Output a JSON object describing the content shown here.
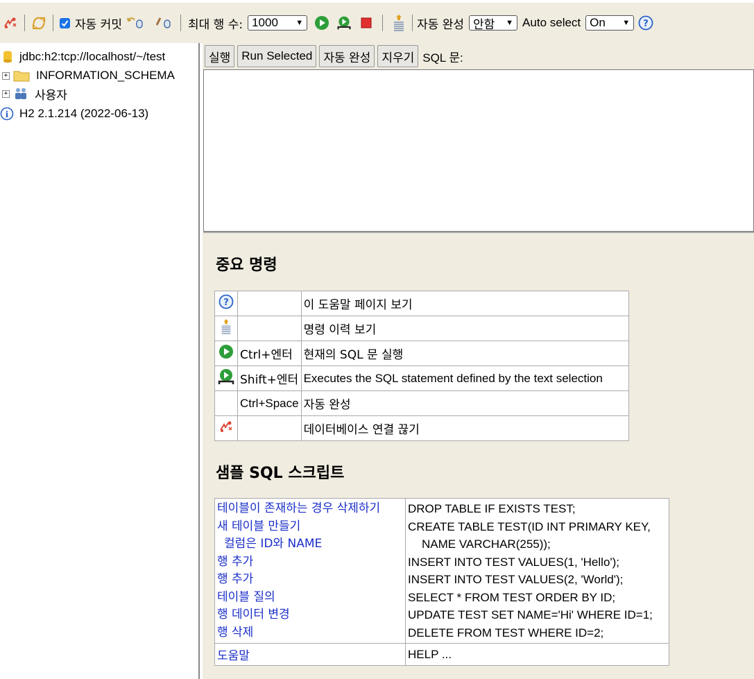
{
  "toolbar": {
    "autocommit_label": "자동 커밋",
    "autocommit_checked": true,
    "max_rows_label": "최대 행 수:",
    "max_rows_value": "1000",
    "autocomplete_label": "자동 완성",
    "autocomplete_value": "안함",
    "autoselect_label": "Auto select",
    "autoselect_value": "On"
  },
  "sidebar": {
    "connection": "jdbc:h2:tcp://localhost/~/test",
    "schema": "INFORMATION_SCHEMA",
    "users": "사용자",
    "version": "H2 2.1.214 (2022-06-13)"
  },
  "query_bar": {
    "run": "실행",
    "run_selected": "Run Selected",
    "autocomplete": "자동 완성",
    "clear": "지우기",
    "sql_label": "SQL 문:"
  },
  "editor": {
    "value": ""
  },
  "help": {
    "important_title": "중요 명령",
    "commands": [
      {
        "icon": "help-icon",
        "key": "",
        "desc": "이 도움말 페이지 보기"
      },
      {
        "icon": "history-icon",
        "key": "",
        "desc": "명령 이력 보기"
      },
      {
        "icon": "run-icon",
        "key": "Ctrl+엔터",
        "desc": "현재의 SQL 문 실행"
      },
      {
        "icon": "run-selected-icon",
        "key": "Shift+엔터",
        "desc": "Executes the SQL statement defined by the text selection"
      },
      {
        "icon": "",
        "key": "Ctrl+Space",
        "desc": "자동 완성"
      },
      {
        "icon": "disconnect-icon",
        "key": "",
        "desc": "데이터베이스 연결 끊기"
      }
    ],
    "sample_title": "샘플 SQL 스크립트",
    "sample_links": [
      "테이블이 존재하는 경우 삭제하기",
      "새 테이블 만들기",
      "컬럼은 ID와 NAME",
      "행 추가",
      "행 추가",
      "테이블 질의",
      "행 데이터 변경",
      "행 삭제"
    ],
    "sample_sql": [
      "DROP TABLE IF EXISTS TEST;",
      "CREATE TABLE TEST(ID INT PRIMARY KEY,",
      "NAME VARCHAR(255));",
      "INSERT INTO TEST VALUES(1, 'Hello');",
      "INSERT INTO TEST VALUES(2, 'World');",
      "SELECT * FROM TEST ORDER BY ID;",
      "UPDATE TEST SET NAME='Hi' WHERE ID=1;",
      "DELETE FROM TEST WHERE ID=2;"
    ],
    "help_link": "도움말",
    "help_sql": "HELP ..."
  },
  "colors": {
    "panel_bg": "#f0ece0",
    "link": "#1a2ec8",
    "run_green": "#2e9e3a",
    "stop_red": "#e03030"
  }
}
